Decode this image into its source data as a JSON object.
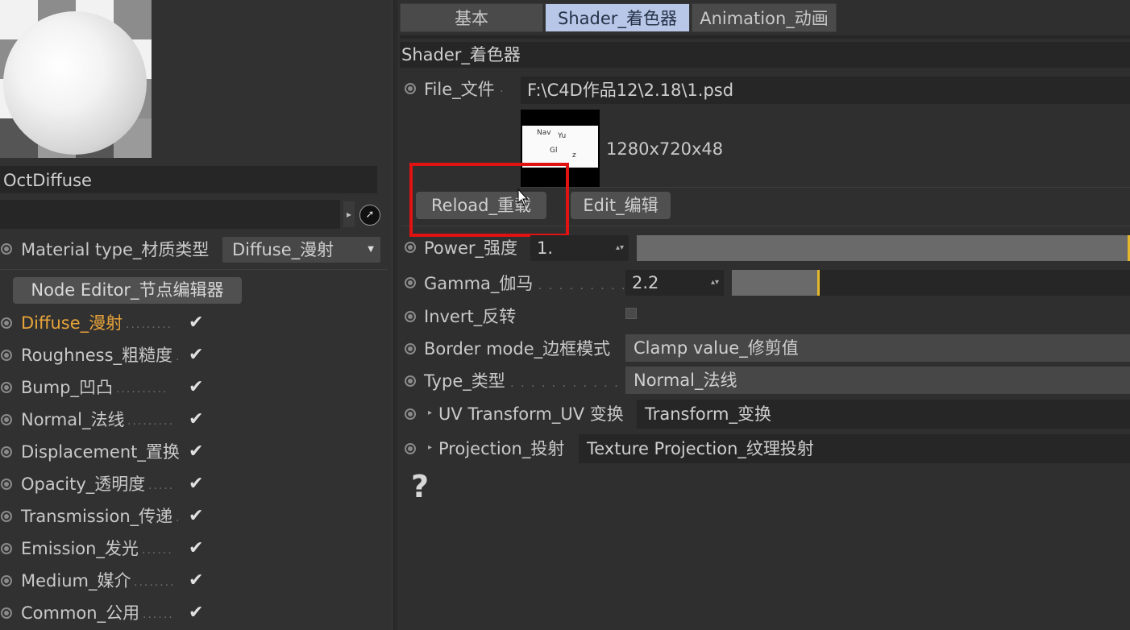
{
  "material": {
    "name": "OctDiffuse",
    "type_label": "Material type_材质类型",
    "type_value": "Diffuse_漫射",
    "node_editor_label": "Node Editor_节点编辑器"
  },
  "channels": [
    {
      "label": "Diffuse_漫射",
      "checked": true,
      "active": true
    },
    {
      "label": "Roughness_粗糙度",
      "checked": true,
      "active": false
    },
    {
      "label": "Bump_凹凸",
      "checked": true,
      "active": false
    },
    {
      "label": "Normal_法线",
      "checked": true,
      "active": false
    },
    {
      "label": "Displacement_置换",
      "checked": true,
      "active": false
    },
    {
      "label": "Opacity_透明度",
      "checked": true,
      "active": false
    },
    {
      "label": "Transmission_传递",
      "checked": true,
      "active": false
    },
    {
      "label": "Emission_发光",
      "checked": true,
      "active": false
    },
    {
      "label": "Medium_媒介",
      "checked": true,
      "active": false
    },
    {
      "label": "Common_公用",
      "checked": true,
      "active": false
    }
  ],
  "check_glyph": "✔",
  "tabs": [
    {
      "label": "基本",
      "selected": false
    },
    {
      "label": "Shader_着色器",
      "selected": true
    },
    {
      "label": "Animation_动画",
      "selected": false
    }
  ],
  "section_title": "Shader_着色器",
  "file": {
    "label": "File_文件",
    "path": "F:\\C4D作品12\\2.18\\1.psd",
    "resolution": "1280x720x48"
  },
  "buttons": {
    "reload": "Reload_重载",
    "edit": "Edit_编辑"
  },
  "params": {
    "power": {
      "label": "Power_强度",
      "value": "1.",
      "slider_fraction": 1.0
    },
    "gamma": {
      "label": "Gamma_伽马",
      "value": "2.2",
      "slider_fraction": 0.22
    },
    "invert": {
      "label": "Invert_反转",
      "checked": false
    },
    "border_mode": {
      "label": "Border mode_边框模式",
      "value": "Clamp value_修剪值"
    },
    "type": {
      "label": "Type_类型",
      "value": "Normal_法线"
    },
    "uv_transform": {
      "label": "UV Transform_UV 变换",
      "value": "Transform_变换"
    },
    "projection": {
      "label": "Projection_投射",
      "value": "Texture Projection_纹理投射"
    }
  },
  "help_glyph": "?",
  "colors": {
    "active_channel": "#e8a33a",
    "selected_tab": "#b8c6e8",
    "slider_marker": "#e5b82b",
    "highlight_box": "#e01212"
  }
}
